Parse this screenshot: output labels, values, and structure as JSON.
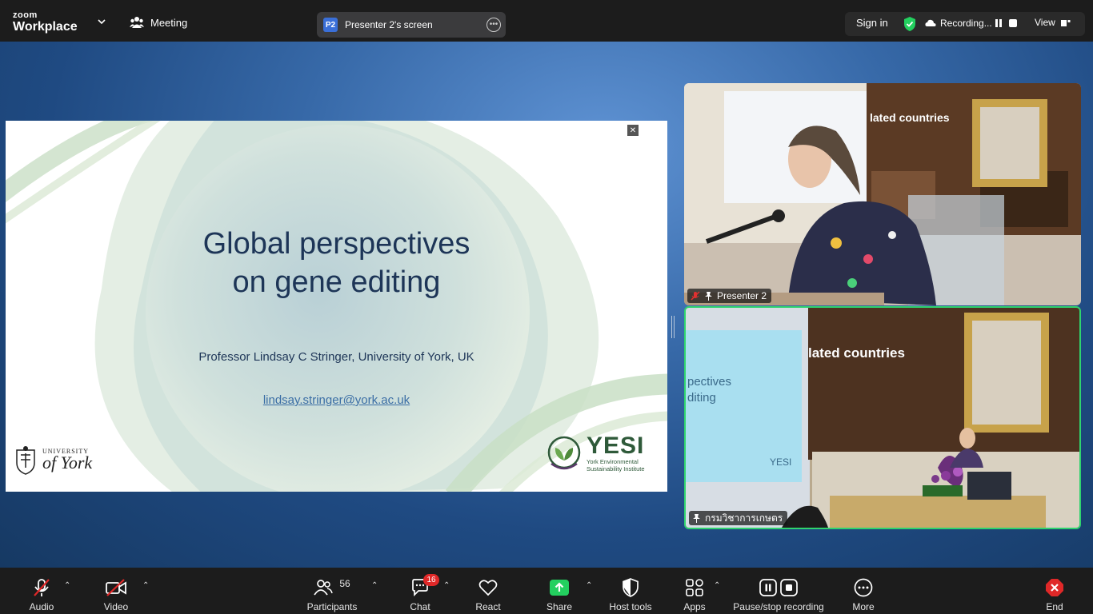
{
  "app": {
    "logo_top": "zoom",
    "logo_bottom": "Workplace"
  },
  "header": {
    "meeting_label": "Meeting",
    "screen_pill_initials": "P2",
    "screen_pill_label": "Presenter 2's screen",
    "sign_in": "Sign in",
    "recording": "Recording...",
    "view": "View"
  },
  "slide": {
    "title_line1": "Global perspectives",
    "title_line2": "on gene editing",
    "author": "Professor Lindsay C Stringer, University of York, UK",
    "email": "lindsay.stringer@york.ac.uk",
    "york_univ": "UNIVERSITY",
    "york_of": "of York",
    "yesi_big": "YESI",
    "yesi_line1": "York Environmental",
    "yesi_line2": "Sustainability Institute"
  },
  "videos": {
    "v1_name": "Presenter 2",
    "v1_banner": "lated countries",
    "v2_name": "กรมวิชาการเกษตร",
    "v2_banner": "lated countries",
    "v2_screen_line1": "pectives",
    "v2_screen_line2": "diting",
    "v2_screen_logo": "YESI"
  },
  "toolbar": {
    "audio": "Audio",
    "video": "Video",
    "participants": "Participants",
    "participants_count": "56",
    "chat": "Chat",
    "chat_badge": "16",
    "react": "React",
    "share": "Share",
    "host_tools": "Host tools",
    "apps": "Apps",
    "pause_stop": "Pause/stop recording",
    "more": "More",
    "end": "End"
  },
  "colors": {
    "accent_green": "#23d05f",
    "end_red": "#e02828",
    "badge_red": "#e02828",
    "slide_text": "#1d3557"
  }
}
